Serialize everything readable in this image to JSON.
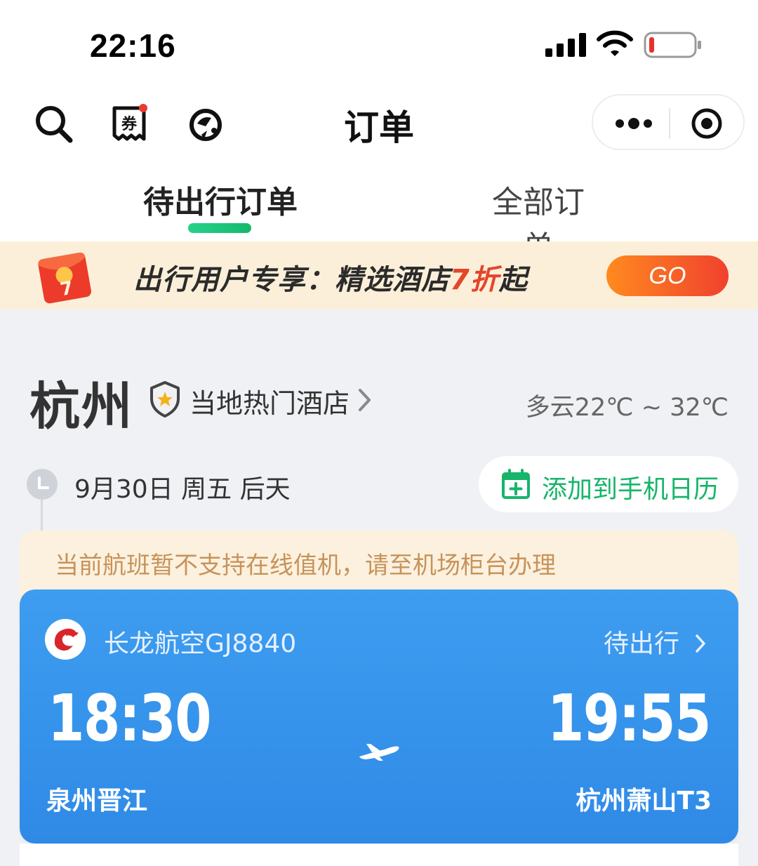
{
  "status_bar": {
    "time": "22:16",
    "battery_color": "#e5322d"
  },
  "nav": {
    "title": "订单"
  },
  "tabs": [
    {
      "label": "待出行订单",
      "active": true
    },
    {
      "label": "全部订单",
      "active": false
    }
  ],
  "promo": {
    "text_prefix": "出行用户专享：精选酒店",
    "text_highlight": "7折",
    "text_suffix": "起",
    "button_label": "GO",
    "badge_text": "7"
  },
  "destination": {
    "city": "杭州",
    "hotel_link": "当地热门酒店",
    "weather": "多云22℃ ~ 32℃"
  },
  "schedule": {
    "date": "9月30日 周五 后天",
    "calendar_button": "添加到手机日历"
  },
  "notice": {
    "text": "当前航班暂不支持在线值机，请至机场柜台办理"
  },
  "flight": {
    "airline": "长龙航空GJ8840",
    "status": "待出行",
    "departure_time": "18:30",
    "arrival_time": "19:55",
    "departure_airport": "泉州晋江",
    "arrival_airport": "杭州萧山T3"
  },
  "colors": {
    "accent_green": "#16b56a",
    "card_blue": "#3596eb",
    "promo_red": "#e5452b",
    "notice_text": "#c7935a"
  }
}
